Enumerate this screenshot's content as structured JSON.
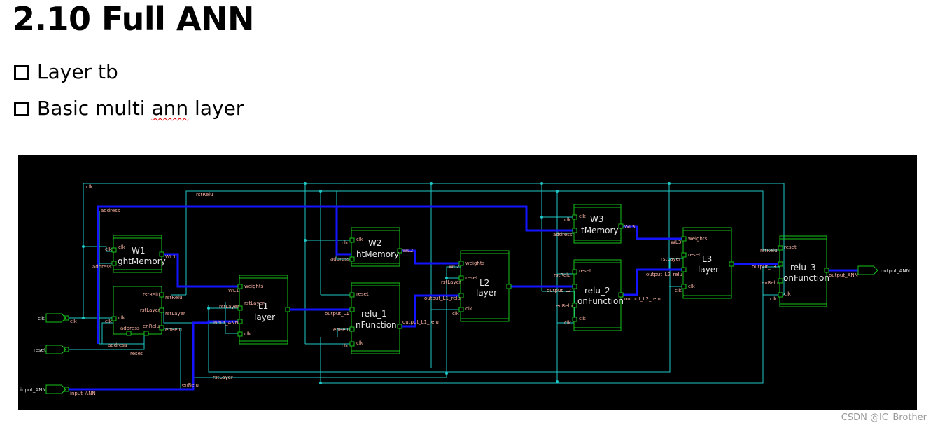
{
  "title": "2.10 Full ANN",
  "bullets": [
    {
      "pre": "Layer tb",
      "wavy": "",
      "post": ""
    },
    {
      "pre": "Basic multi ",
      "wavy": "ann",
      "post": " layer"
    }
  ],
  "watermark": "CSDN @IC_Brother",
  "colors": {
    "wire": "#1fc8c8",
    "bus": "#1414ff",
    "block": "#19c419",
    "port_label": "#f5b0a0",
    "background": "#000000"
  },
  "schematic": {
    "inputs": [
      "clk",
      "reset",
      "input_ANN"
    ],
    "output": "output_ANN",
    "net_labels": {
      "clk": "clk",
      "rstRelu": "rstRelu",
      "address": "address",
      "address2": "address",
      "reset": "reset",
      "enRelu": "enRelu",
      "rstLayer": "rstLayer",
      "input_ann": "input_ANN",
      "wl1": "WL1",
      "wl2": "WL2",
      "wl3": "WL3",
      "out_l1": "output_L1",
      "out_l1_relu": "output_L1_relu",
      "out_l2": "output_L2",
      "out_l2_relu": "output_L2_relu",
      "out_l3": "output_L3",
      "out_ann": "output_ANN"
    },
    "blocks": [
      {
        "id": "w1",
        "name": "W1",
        "label": "ghtMemory",
        "ports_in": [
          "clk",
          "address"
        ],
        "ports_out": [
          "WL1"
        ]
      },
      {
        "id": "w2",
        "name": "W2",
        "label": "htMemory",
        "ports_in": [
          "clk",
          "address"
        ],
        "ports_out": [
          "WL2"
        ]
      },
      {
        "id": "w3",
        "name": "W3",
        "label": "tMemory",
        "ports_in": [
          "clk",
          "address"
        ],
        "ports_out": [
          "WL3"
        ]
      },
      {
        "id": "ctl",
        "name": "",
        "label": "",
        "ports_in": [
          "rstRelu",
          "rstLayer",
          "clk",
          "address",
          "enRelu"
        ],
        "ports_out": []
      },
      {
        "id": "l1",
        "name": "L1",
        "label": "layer",
        "ports_in": [
          "weights",
          "rstLayer",
          "input_ANN",
          "clk"
        ],
        "ports_out": []
      },
      {
        "id": "relu1",
        "name": "relu_1",
        "label": "nFunction",
        "ports_in": [
          "reset",
          "output_L1",
          "enRelu",
          "clk"
        ],
        "ports_out": [
          "output_L1_relu"
        ]
      },
      {
        "id": "l2",
        "name": "L2",
        "label": "layer",
        "ports_in": [
          "weights",
          "reset",
          "output_L1_relu",
          "clk"
        ],
        "ports_out": []
      },
      {
        "id": "relu2",
        "name": "relu_2",
        "label": "onFunction",
        "ports_in": [
          "reset",
          "output_L2",
          "enRelu",
          "clk"
        ],
        "ports_out": [
          "output_L2_relu"
        ]
      },
      {
        "id": "l3",
        "name": "L3",
        "label": "layer",
        "ports_in": [
          "weights",
          "reset",
          "output_L2_relu",
          "clk"
        ],
        "ports_out": []
      },
      {
        "id": "relu3",
        "name": "relu_3",
        "label": "onFunction",
        "ports_in": [
          "reset",
          "output_L3",
          "enRelu",
          "clk"
        ],
        "ports_out": [
          "output_ANN"
        ]
      }
    ]
  }
}
